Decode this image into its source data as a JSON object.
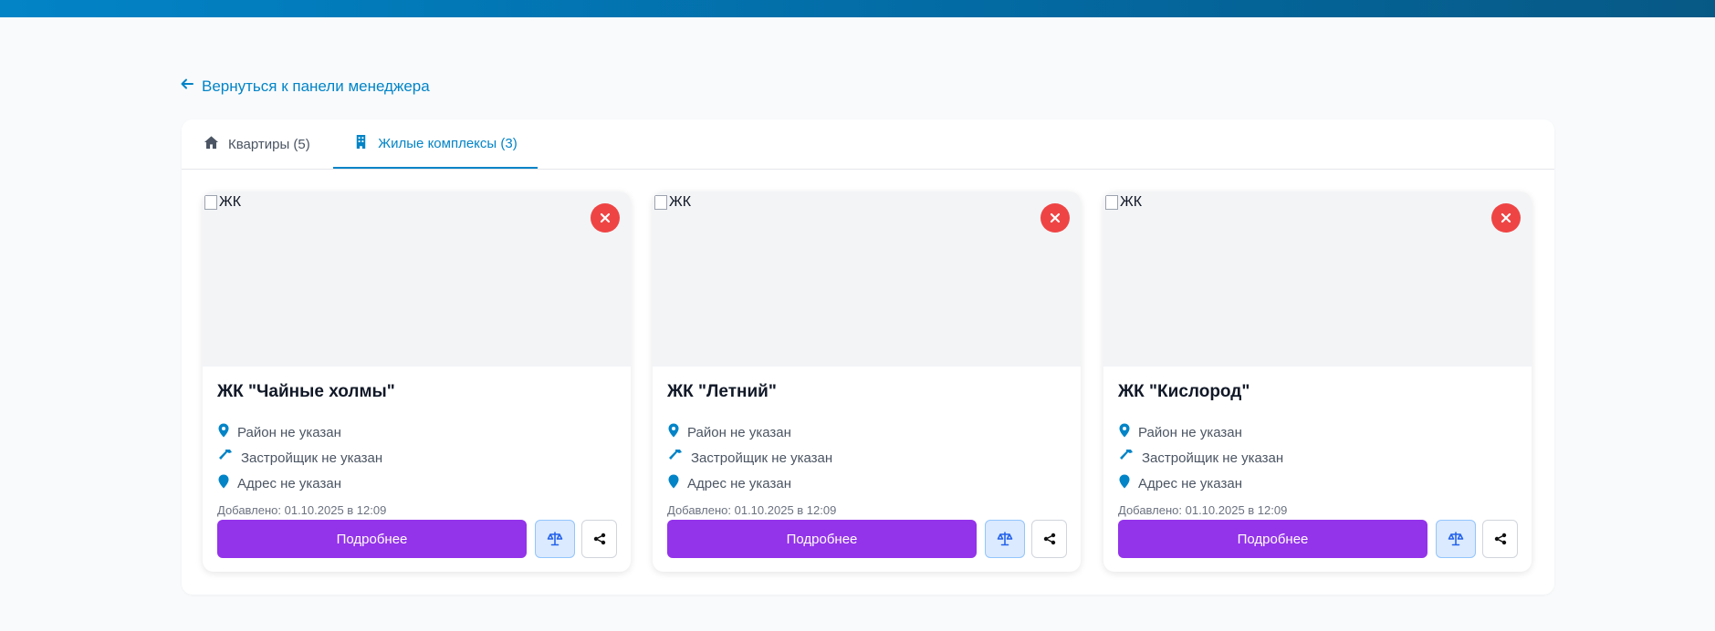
{
  "colors": {
    "accent": "#0284c7",
    "primary_button": "#9333ea",
    "danger": "#ef4444",
    "compare_bg": "#dbeafe"
  },
  "back_link": {
    "label": "Вернуться к панели менеджера",
    "icon": "arrow-left-icon"
  },
  "tabs": [
    {
      "label": "Квартиры (5)",
      "icon": "home-icon",
      "active": false
    },
    {
      "label": "Жилые комплексы (3)",
      "icon": "building-icon",
      "active": true
    }
  ],
  "cards": [
    {
      "image_alt": "ЖК",
      "title": "ЖК \"Чайные холмы\"",
      "district": "Район не указан",
      "developer": "Застройщик не указан",
      "address": "Адрес не указан",
      "added": "Добавлено: 01.10.2025 в 12:09",
      "details_label": "Подробнее"
    },
    {
      "image_alt": "ЖК",
      "title": "ЖК \"Летний\"",
      "district": "Район не указан",
      "developer": "Застройщик не указан",
      "address": "Адрес не указан",
      "added": "Добавлено: 01.10.2025 в 12:09",
      "details_label": "Подробнее"
    },
    {
      "image_alt": "ЖК",
      "title": "ЖК \"Кислород\"",
      "district": "Район не указан",
      "developer": "Застройщик не указан",
      "address": "Адрес не указан",
      "added": "Добавлено: 01.10.2025 в 12:09",
      "details_label": "Подробнее"
    }
  ]
}
